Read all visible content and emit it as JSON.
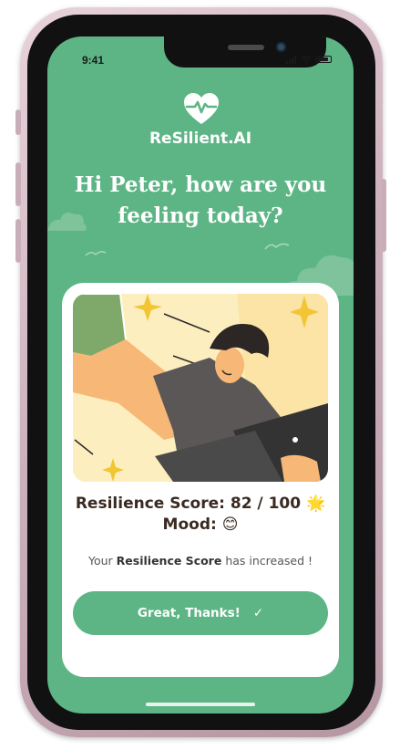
{
  "status_bar": {
    "time": "9:41"
  },
  "app": {
    "brand": "ReSilient.AI"
  },
  "greeting": {
    "line1": "Hi Peter, how are you",
    "line2": "feeling today?"
  },
  "card": {
    "score_label": "Resilience Score:",
    "score_value": "82 / 100",
    "score_emoji": "🌟",
    "mood_label": "Mood:",
    "mood_emoji": "😊",
    "info_prefix": "Your",
    "info_bold": "Resilience Score",
    "info_suffix": "has increased !",
    "cta_label": "Great, Thanks!",
    "cta_icon": "✓"
  },
  "colors": {
    "brand_green": "#5db585",
    "illustration_bg": "#fdeec0"
  },
  "icons": [
    "heart-pulse-icon",
    "signal-icon",
    "wifi-icon",
    "battery-icon",
    "check-icon"
  ]
}
